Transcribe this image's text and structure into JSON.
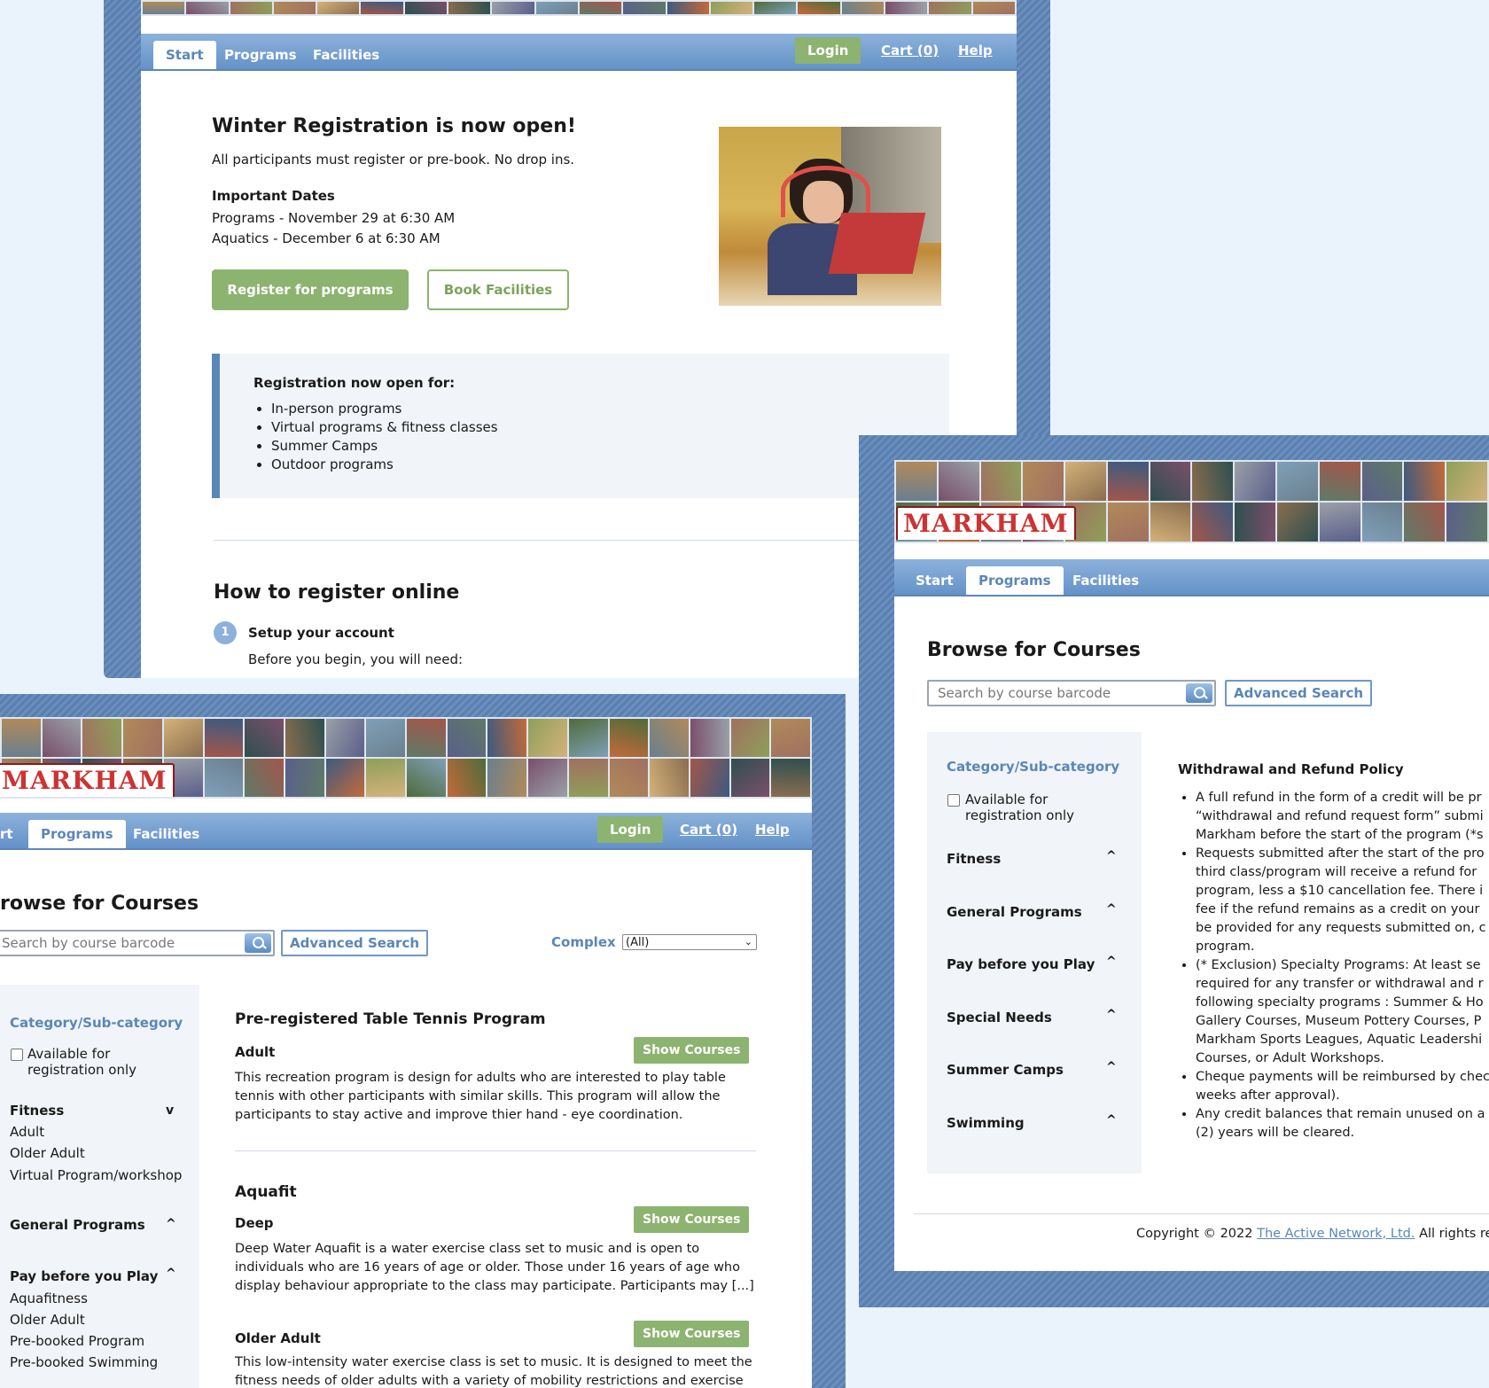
{
  "banner_logo": "MARKHAM",
  "window1": {
    "tabs": [
      "Start",
      "Programs",
      "Facilities"
    ],
    "active_tab": "Start",
    "login": "Login",
    "cart": "Cart (0)",
    "help": "Help",
    "headline": "Winter Registration is now open!",
    "intro": "All participants must register or pre-book. No drop ins.",
    "dates_title": "Important Dates",
    "dates": [
      "Programs - November 29 at 6:30 AM",
      "Aquatics - December 6 at 6:30 AM"
    ],
    "register_btn": "Register for programs",
    "book_btn": "Book Facilities",
    "open_title": "Registration now open for:",
    "open_items": [
      "In-person programs",
      "Virtual programs & fitness classes",
      "Summer Camps",
      "Outdoor programs"
    ],
    "howto_title": "How to register online",
    "step_num": "1",
    "step_title": "Setup your account",
    "step_text": "Before you begin, you will need:"
  },
  "window2": {
    "tab_start_partial": "rt",
    "tabs": [
      "Programs",
      "Facilities"
    ],
    "login": "Login",
    "cart": "Cart (0)",
    "help": "Help",
    "title": "rowse for Courses",
    "search_placeholder": "Search by course barcode",
    "advanced": "Advanced Search",
    "complex_label": "Complex",
    "complex_value": "(All)",
    "sidebar": {
      "title": "Category/Sub-category",
      "avail_line1": "Available for",
      "avail_line2": "registration only",
      "fitness": "Fitness",
      "fitness_caret": "v",
      "fitness_subs": [
        "Adult",
        "Older Adult",
        "Virtual Program/workshop"
      ],
      "general": "General Programs",
      "general_caret": "^",
      "pay": "Pay before you Play",
      "pay_caret": "^",
      "pay_subs": [
        "Aquafitness",
        "Older Adult",
        "Pre-booked Program",
        "Pre-booked Swimming"
      ]
    },
    "programs": [
      {
        "title": "Pre-registered Table Tennis Program",
        "sub": "Adult",
        "button": "Show Courses",
        "desc_lines": [
          "This recreation program is design for adults who are interested to play table",
          "tennis with other participants with similar skills. This program will allow the",
          "participants to stay active and improve thier hand - eye coordination."
        ]
      },
      {
        "title": "Aquafit",
        "sub": "Deep",
        "button": "Show Courses",
        "desc_lines": [
          "Deep Water Aquafit is a water exercise class set to music and is open to",
          "individuals who are 16 years of age or older. Those under 16 years of age who",
          "display behaviour appropriate to the class may participate. Participants may [...]"
        ]
      },
      {
        "sub": "Older Adult",
        "button": "Show Courses",
        "desc_lines": [
          "This low-intensity water exercise class is set to music. It is designed to meet the",
          "fitness needs of older adults with a variety of mobility restrictions and exercise"
        ]
      }
    ]
  },
  "window3": {
    "tabs": [
      "Start",
      "Programs",
      "Facilities"
    ],
    "active_tab": "Programs",
    "title": "Browse for Courses",
    "search_placeholder": "Search by course barcode",
    "advanced": "Advanced Search",
    "sidebar": {
      "title": "Category/Sub-category",
      "avail_line1": "Available for",
      "avail_line2": "registration only",
      "categories": [
        "Fitness",
        "General Programs",
        "Pay before you Play",
        "Special Needs",
        "Summer Camps",
        "Swimming"
      ],
      "caret": "^"
    },
    "policy_title": "Withdrawal and Refund Policy",
    "policy_items": [
      [
        "A full refund in the form of a credit will be pr",
        "“withdrawal and refund request form” submi",
        "Markham before the start of the program (*s"
      ],
      [
        "Requests submitted after the start of the pro",
        "third class/program will receive a refund for",
        "program, less a $10 cancellation fee. There i",
        "fee if the refund remains as a credit on your",
        "be provided for any requests submitted on, c",
        "program."
      ],
      [
        "(* Exclusion) Specialty Programs: At least se",
        "required for any transfer or withdrawal and r",
        "following specialty programs : Summer & Ho",
        "Gallery Courses, Museum Pottery Courses, P",
        "Markham Sports Leagues, Aquatic Leadershi",
        "Courses, or Adult Workshops."
      ],
      [
        "Cheque payments will be reimbursed by chec",
        "weeks after approval)."
      ],
      [
        "Any credit balances that remain unused on a",
        "(2) years will be cleared."
      ]
    ],
    "copyright_prefix": "Copyright © 2022 ",
    "copyright_link": "The Active Network, Ltd.",
    "copyright_suffix": " All rights res"
  }
}
